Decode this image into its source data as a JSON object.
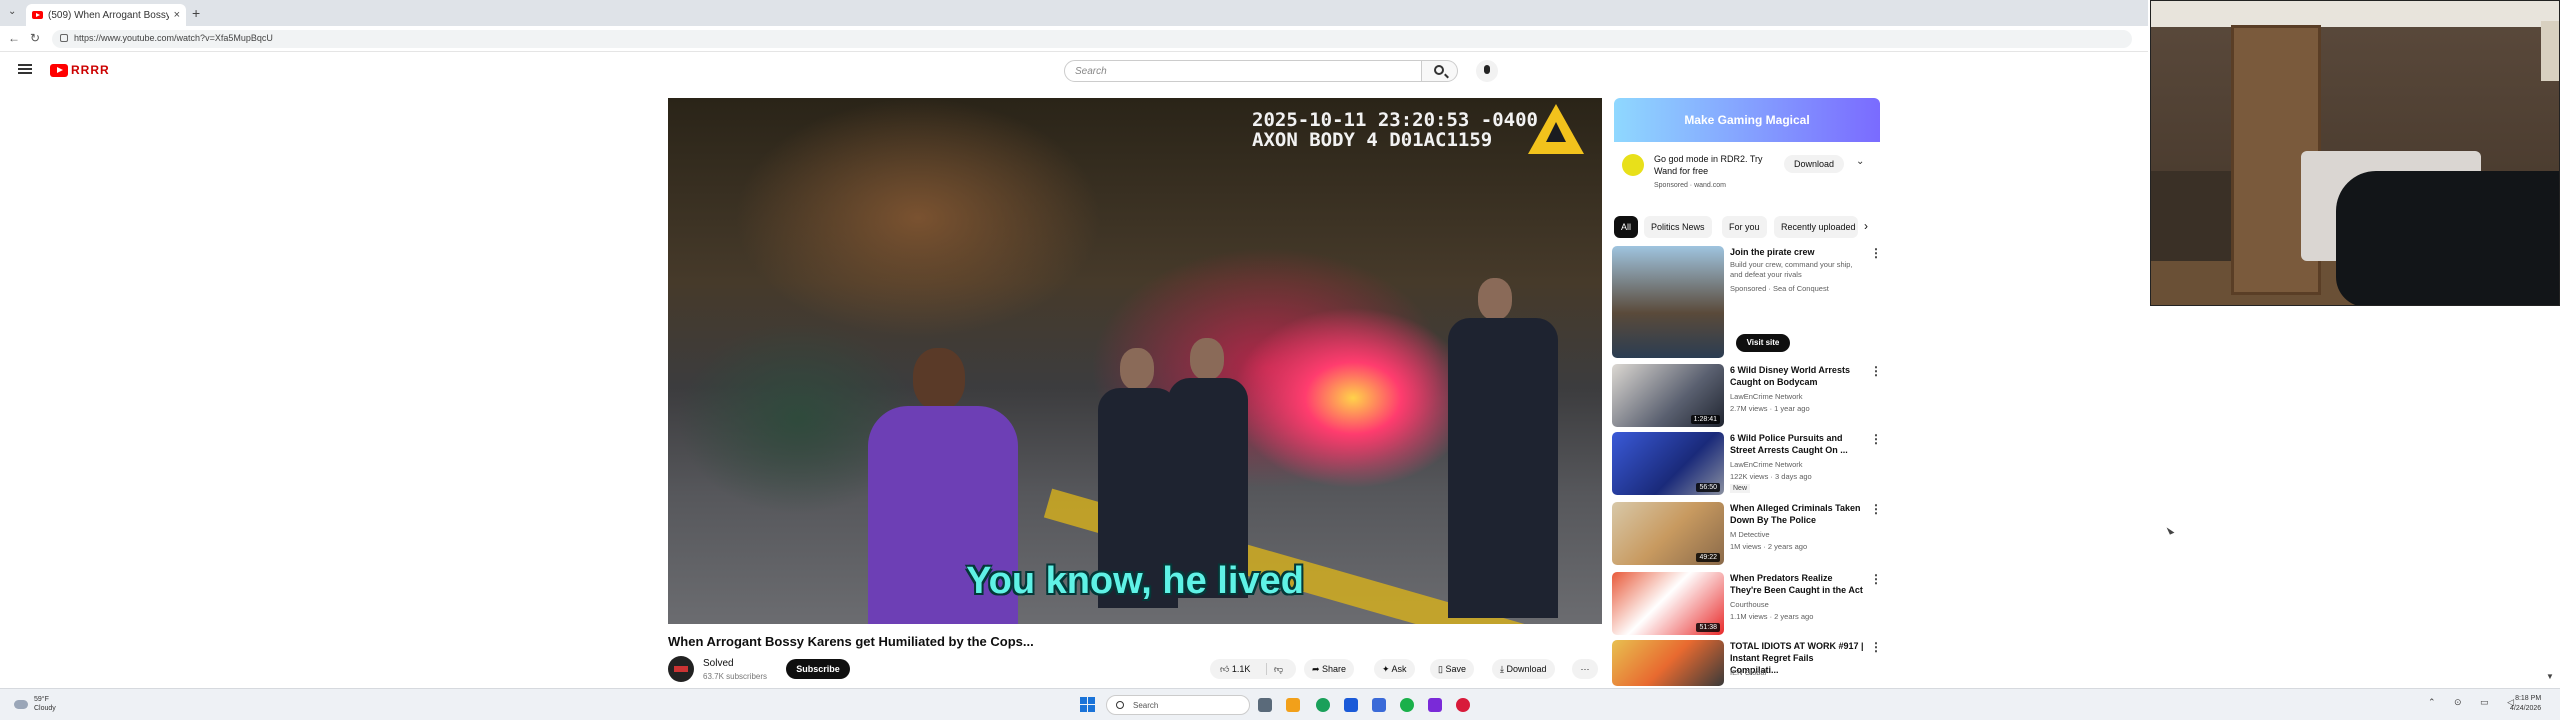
{
  "browser": {
    "tab_title": "(509) When Arrogant Bossy",
    "tab_close": "×",
    "new_tab": "+",
    "tab_menu": "⌄",
    "back": "←",
    "reload": "↻",
    "url": "https://www.youtube.com/watch?v=Xfa5MupBqcU"
  },
  "masthead": {
    "logo_text": "RRRR",
    "search_placeholder": "Search"
  },
  "player": {
    "osd_line1": "2025-10-11 23:20:53 -0400",
    "osd_line2": "AXON BODY 4 D01AC1159",
    "caption": "You know, he lived"
  },
  "video": {
    "title": "When Arrogant Bossy Karens get Humiliated by the Cops...",
    "channel": "Solved",
    "subscribers": "63.7K subscribers",
    "subscribe_label": "Subscribe",
    "likes": "1.1K",
    "share_label": "Share",
    "ask_label": "Ask",
    "save_label": "Save",
    "download_label": "Download",
    "more_label": "···"
  },
  "sidebar": {
    "ad": {
      "banner": "Make Gaming Magical",
      "text": "Go god mode in RDR2. Try Wand for free",
      "sponsored": "Sponsored · wand.com",
      "download": "Download",
      "chevron": "⌄"
    },
    "chips": [
      "All",
      "Politics News",
      "For you",
      "Recently uploaded"
    ],
    "chip_next": "›",
    "recommendations": [
      {
        "title": "Join the pirate crew",
        "channel": "Build your crew, command your ship, and defeat your rivals",
        "meta": "Sponsored · Sea of Conquest",
        "duration": "",
        "cta": "Visit site"
      },
      {
        "title": "6 Wild Disney World Arrests Caught on Bodycam",
        "channel": "LawEnCrime Network",
        "meta": "2.7M views · 1 year ago",
        "duration": "1:28:41"
      },
      {
        "title": "6 Wild Police Pursuits and Street Arrests Caught On ...",
        "channel": "LawEnCrime Network",
        "meta": "122K views · 3 days ago",
        "duration": "56:50",
        "badge": "New"
      },
      {
        "title": "When Alleged Criminals Taken Down By The Police",
        "channel": "M Detective",
        "meta": "1M views · 2 years ago",
        "duration": "49:22"
      },
      {
        "title": "When Predators Realize They're Been Caught in the Act",
        "channel": "Courthouse",
        "meta": "1.1M views · 2 years ago",
        "duration": "51:38"
      },
      {
        "title": "TOTAL IDIOTS AT WORK #917 | Instant Regret Fails Compilati...",
        "channel": "IEN Global",
        "meta": "",
        "duration": ""
      }
    ],
    "kebab": "⋮"
  },
  "taskbar": {
    "weather_temp": "59°F",
    "weather_desc": "Cloudy",
    "search_label": "Search",
    "time": "8:18 PM",
    "date": "4/24/2026"
  },
  "icon_names": [
    "search-icon",
    "mic-icon",
    "like-icon",
    "dislike-icon",
    "share-icon",
    "save-icon",
    "download-icon",
    "windows-start-icon"
  ]
}
